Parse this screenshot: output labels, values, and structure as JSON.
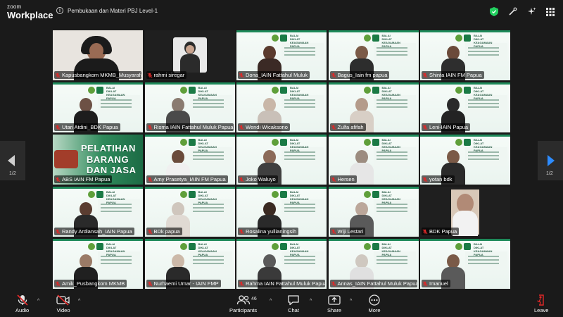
{
  "app": {
    "brand_line1": "zoom",
    "brand_line2": "Workplace"
  },
  "meeting": {
    "title": "Pembukaan dan Materi PBJ Level-1"
  },
  "gallery": {
    "page_left": "1/2",
    "page_right": "1/2",
    "tiles": [
      {
        "name": "Kapusbangkom MKMB_Musyarafah",
        "bg": "person",
        "skin": "#9a6b54",
        "cloth": "#1b1b1b",
        "active": true
      },
      {
        "name": "rahmi siregar",
        "bg": "photo"
      },
      {
        "name": "Dona_IAIN Fattahul Muluk",
        "bg": "banner",
        "skin": "#5a3b2e",
        "cloth": "#3b2a25"
      },
      {
        "name": "Bagus_Iain fm papua",
        "bg": "banner",
        "skin": "#7b5a47",
        "cloth": "#2d2d2d"
      },
      {
        "name": "Shinta IAIN FM Papua",
        "bg": "banner",
        "skin": "#6b4a3a",
        "cloth": "#2e2e2e"
      },
      {
        "name": "Utari Atdini_BDK Papua",
        "bg": "banner",
        "skin": "#6d5145",
        "cloth": "#1d1d1d"
      },
      {
        "name": "Risma IAIN Fattahul Muluk Papua",
        "bg": "banner",
        "skin": "#8a7b70",
        "cloth": "#4a4a4a"
      },
      {
        "name": "Wendi Wicaksono",
        "bg": "banner",
        "skin": "#c9b7a8",
        "cloth": "#c9c0b8"
      },
      {
        "name": "Zulfa afifah",
        "bg": "banner",
        "skin": "#b49b8a",
        "cloth": "#d8cfc6"
      },
      {
        "name": "Leni-IAIN Papua",
        "bg": "banner",
        "skin": "#2a2a2a",
        "cloth": "#232323"
      },
      {
        "name": "ABS IAIN FM Papua",
        "bg": "pelatihan"
      },
      {
        "name": "Amy Prasetya_IAIN FM Papua",
        "bg": "banner",
        "skin": "#6a4b3b",
        "cloth": "#f0f0f0"
      },
      {
        "name": "Joko Waluyo",
        "bg": "banner",
        "skin": "#8b6a58",
        "cloth": "#3f3f3f"
      },
      {
        "name": "Hersen",
        "bg": "banner",
        "skin": "#9c8c80",
        "cloth": "#e6e6e6"
      },
      {
        "name": "yotan bdk",
        "bg": "banner",
        "skin": "#7b5a47",
        "cloth": "#2a2a2a"
      },
      {
        "name": "Randy Ardiansah_IAIN Papua",
        "bg": "banner",
        "skin": "#5b3d31",
        "cloth": "#2a2a2a"
      },
      {
        "name": "BDk papua",
        "bg": "banner",
        "skin": "#cfc6bd",
        "cloth": "#e0dad3"
      },
      {
        "name": "Rosalina yullianingsih",
        "bg": "banner",
        "skin": "#3a2a22",
        "cloth": "#2a2a2a"
      },
      {
        "name": "Wiji Lestari",
        "bg": "banner",
        "skin": "#bba79a",
        "cloth": "#5a5a5a"
      },
      {
        "name": "BDK Papua",
        "bg": "dark",
        "skin": "#b18a76",
        "cloth": "#f2f2f2"
      },
      {
        "name": "Amik_Pusbangkom MKMB",
        "bg": "banner",
        "skin": "#9a7a66",
        "cloth": "#202020"
      },
      {
        "name": "Nurhaemi Umar - IAIN FMP",
        "bg": "banner",
        "skin": "#ccb9a9",
        "cloth": "#2a2a2a"
      },
      {
        "name": "Rahma IAIN Fattahul Muluk Papua",
        "bg": "banner",
        "skin": "#5a5a5a",
        "cloth": "#3a3a3a"
      },
      {
        "name": "Annas_IAIN Fattahul Muluk Papua",
        "bg": "banner",
        "skin": "#cfc8c0",
        "cloth": "#e0e0e0"
      },
      {
        "name": "Imanuel",
        "bg": "banner",
        "skin": "#7a5a48",
        "cloth": "#5a5a5a"
      }
    ],
    "banner_text": "BALAI\nDIKLAT\nKEAGAMAAN\nPAPUA",
    "pelatihan_line1": "PELATIHAN",
    "pelatihan_line2": "BARANG",
    "pelatihan_line3": "DAN JASA"
  },
  "toolbar": {
    "audio": "Audio",
    "video": "Video",
    "participants": "Participants",
    "participants_count": "46",
    "chat": "Chat",
    "share": "Share",
    "more": "More",
    "leave": "Leave"
  },
  "colors": {
    "active_border": "#23d160",
    "muted": "#e02828",
    "shield": "#23d160",
    "leave": "#e02828"
  }
}
